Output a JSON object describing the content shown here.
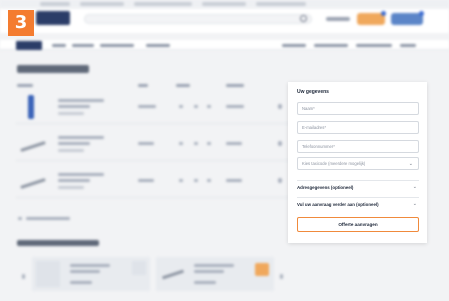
{
  "step_badge": {
    "number": "3"
  },
  "quote_form": {
    "title": "Uw gegevens",
    "fields": [
      {
        "placeholder": "Naam*"
      },
      {
        "placeholder": "E-mailadres*"
      },
      {
        "placeholder": "Telefoonnummer*"
      },
      {
        "placeholder": "Kies taxicode (meerdere mogelijk)"
      }
    ],
    "sections": [
      {
        "label": "Adresgegevens (optioneel)"
      },
      {
        "label": "Vul uw aanvraag verder aan (optioneel)"
      }
    ],
    "submit_label": "Offerte aanvragen"
  },
  "colors": {
    "accent_orange": "#f47c30",
    "brand_navy": "#2b3d68"
  }
}
